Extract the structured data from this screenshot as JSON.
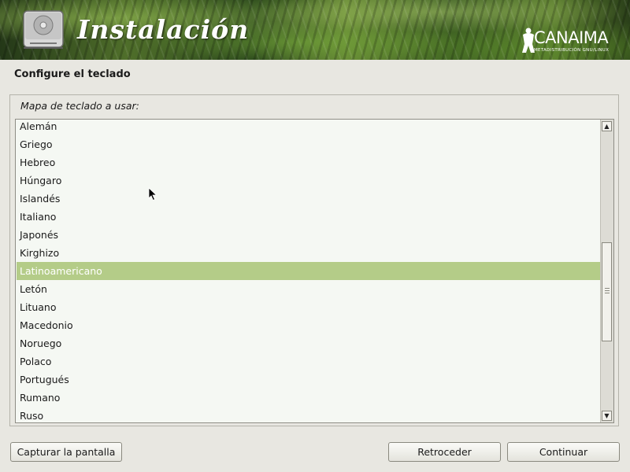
{
  "banner": {
    "title": "Instalación",
    "logo_name": "CANAIMA",
    "logo_subtitle": "METADISTRIBUCIÓN GNU/LINUX",
    "icons": [
      "disk-icon",
      "canaima-logo-icon"
    ]
  },
  "page": {
    "heading": "Configure el teclado",
    "field_label": "Mapa de teclado a usar:"
  },
  "keymap_list": {
    "items": [
      "Alemán",
      "Griego",
      "Hebreo",
      "Húngaro",
      "Islandés",
      "Italiano",
      "Japonés",
      "Kirghizo",
      "Latinoamericano",
      "Letón",
      "Lituano",
      "Macedonio",
      "Noruego",
      "Polaco",
      "Portugués",
      "Rumano",
      "Ruso"
    ],
    "selected": "Latinoamericano",
    "selected_color": "#b4cc88"
  },
  "buttons": {
    "screenshot": "Capturar la pantalla",
    "back": "Retroceder",
    "continue": "Continuar"
  }
}
